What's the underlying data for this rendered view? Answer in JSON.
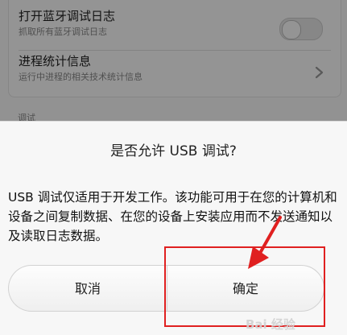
{
  "settings": {
    "bluetooth_log": {
      "title": "打开蓝牙调试日志",
      "subtitle": "抓取所有蓝牙调试日志"
    },
    "process_stats": {
      "title": "进程统计信息",
      "subtitle": "运行中进程的相关技术统计信息"
    },
    "section_hint": "调试"
  },
  "dialog": {
    "title": "是否允许 USB 调试?",
    "message": "USB 调试仅适用于开发工作。该功能可用于在您的计算机和设备之间复制数据、在您的设备上安装应用而不发送通知以及读取日志数据。",
    "cancel_label": "取消",
    "ok_label": "确定"
  },
  "watermark": {
    "text": "Bai 经验",
    "logo": "baidu-jingyan-logo"
  },
  "colors": {
    "annotation": "#e02020",
    "dialog_bg": "#f7f7f7"
  },
  "icons": {
    "toggle": "toggle-switch",
    "chevron": "chevron-right-icon",
    "arrow": "red-pointer-arrow-icon"
  }
}
